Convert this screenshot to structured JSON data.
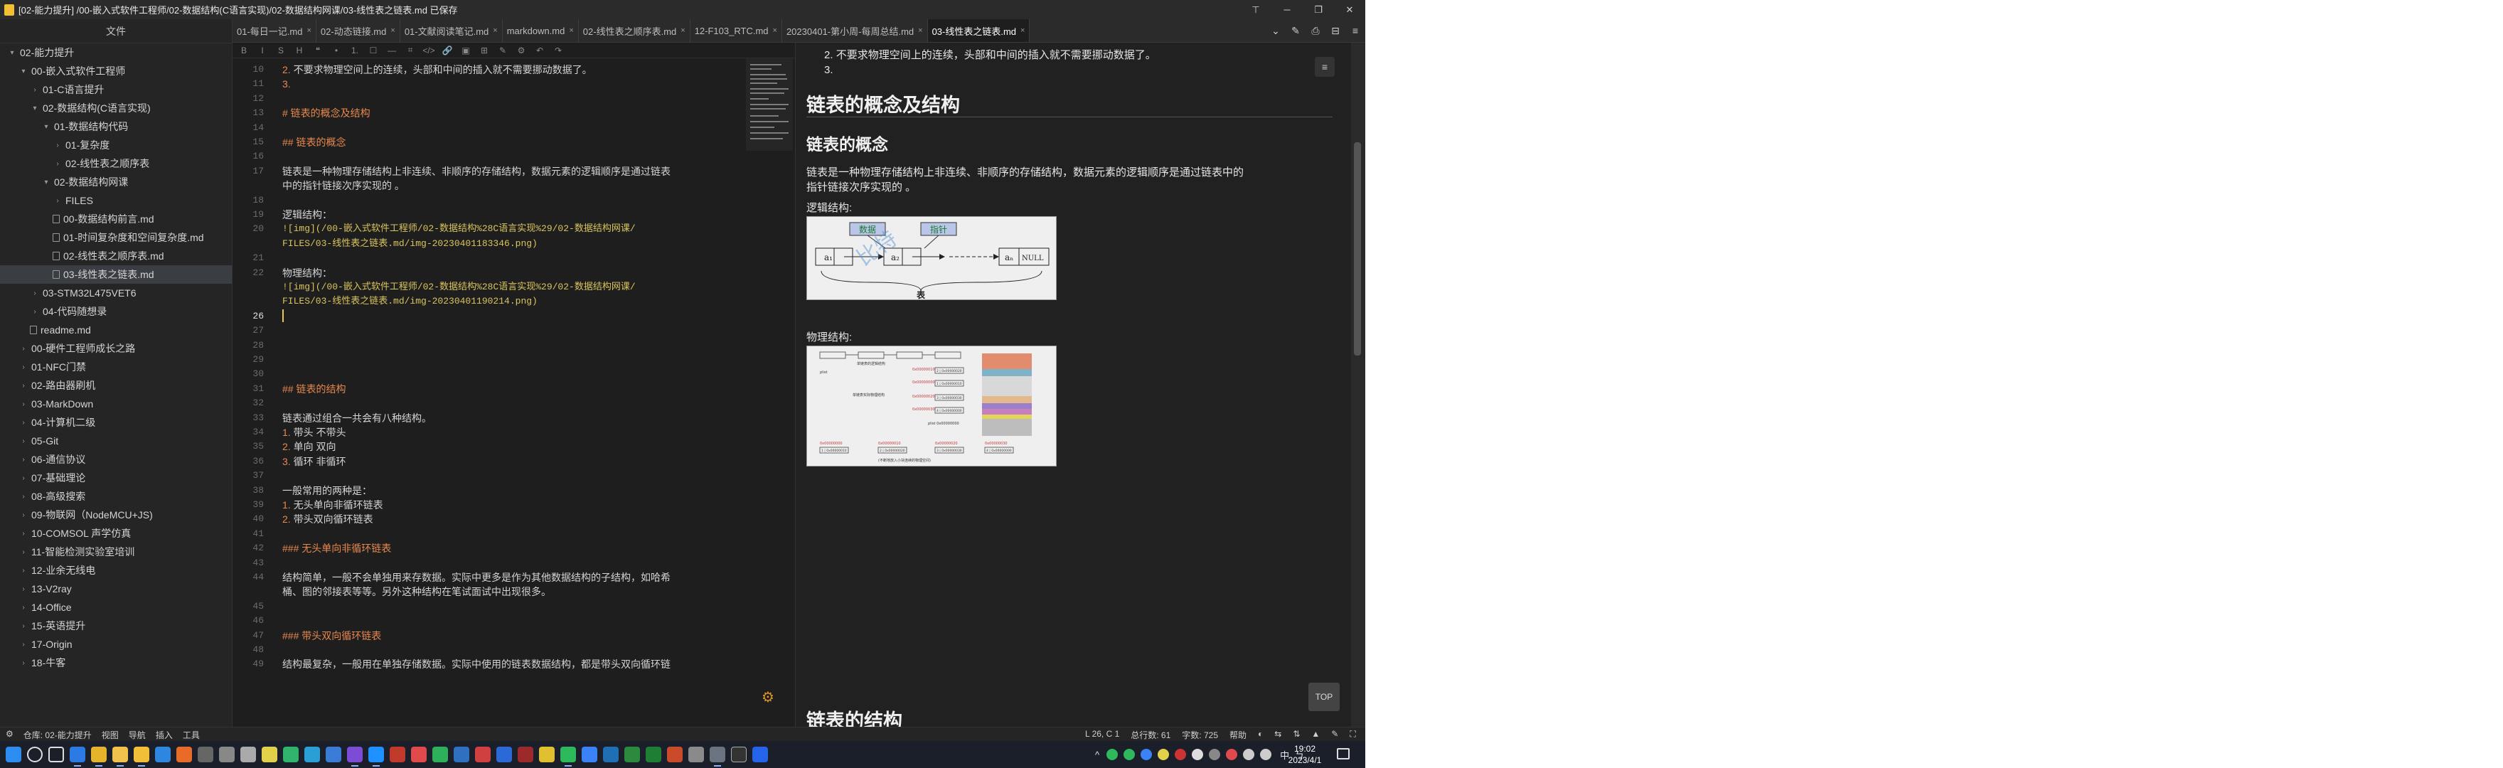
{
  "window": {
    "title": "[02-能力提升] /00-嵌入式软件工程师/02-数据结构(C语言实现)/02-数据结构网课/03-线性表之链表.md 已保存",
    "controls": [
      "─",
      "❐",
      "✕"
    ],
    "pin_label": "⊤"
  },
  "sidebar": {
    "header": "文件",
    "items": [
      {
        "label": "02-能力提升",
        "arrow": "▾",
        "indent": 10,
        "kind": "folder"
      },
      {
        "label": "00-嵌入式软件工程师",
        "arrow": "▾",
        "indent": 26,
        "kind": "folder"
      },
      {
        "label": "01-C语言提升",
        "arrow": "›",
        "indent": 42,
        "kind": "folder"
      },
      {
        "label": "02-数据结构(C语言实现)",
        "arrow": "▾",
        "indent": 42,
        "kind": "folder"
      },
      {
        "label": "01-数据结构代码",
        "arrow": "▾",
        "indent": 58,
        "kind": "folder"
      },
      {
        "label": "01-复杂度",
        "arrow": "›",
        "indent": 74,
        "kind": "folder"
      },
      {
        "label": "02-线性表之顺序表",
        "arrow": "›",
        "indent": 74,
        "kind": "folder"
      },
      {
        "label": "02-数据结构网课",
        "arrow": "▾",
        "indent": 58,
        "kind": "folder"
      },
      {
        "label": "FILES",
        "arrow": "›",
        "indent": 74,
        "kind": "folder"
      },
      {
        "label": "00-数据结构前言.md",
        "arrow": "",
        "indent": 74,
        "kind": "file"
      },
      {
        "label": "01-时间复杂度和空间复杂度.md",
        "arrow": "",
        "indent": 74,
        "kind": "file"
      },
      {
        "label": "02-线性表之顺序表.md",
        "arrow": "",
        "indent": 74,
        "kind": "file"
      },
      {
        "label": "03-线性表之链表.md",
        "arrow": "",
        "indent": 74,
        "kind": "file",
        "selected": true
      },
      {
        "label": "03-STM32L475VET6",
        "arrow": "›",
        "indent": 42,
        "kind": "folder"
      },
      {
        "label": "04-代码随想录",
        "arrow": "›",
        "indent": 42,
        "kind": "folder"
      },
      {
        "label": "readme.md",
        "arrow": "",
        "indent": 42,
        "kind": "file"
      },
      {
        "label": "00-硬件工程师成长之路",
        "arrow": "›",
        "indent": 26,
        "kind": "folder"
      },
      {
        "label": "01-NFC门禁",
        "arrow": "›",
        "indent": 26,
        "kind": "folder"
      },
      {
        "label": "02-路由器刷机",
        "arrow": "›",
        "indent": 26,
        "kind": "folder"
      },
      {
        "label": "03-MarkDown",
        "arrow": "›",
        "indent": 26,
        "kind": "folder"
      },
      {
        "label": "04-计算机二级",
        "arrow": "›",
        "indent": 26,
        "kind": "folder"
      },
      {
        "label": "05-Git",
        "arrow": "›",
        "indent": 26,
        "kind": "folder"
      },
      {
        "label": "06-通信协议",
        "arrow": "›",
        "indent": 26,
        "kind": "folder"
      },
      {
        "label": "07-基础理论",
        "arrow": "›",
        "indent": 26,
        "kind": "folder"
      },
      {
        "label": "08-高级搜索",
        "arrow": "›",
        "indent": 26,
        "kind": "folder"
      },
      {
        "label": "09-物联网（NodeMCU+JS)",
        "arrow": "›",
        "indent": 26,
        "kind": "folder"
      },
      {
        "label": "10-COMSOL 声学仿真",
        "arrow": "›",
        "indent": 26,
        "kind": "folder"
      },
      {
        "label": "11-智能检测实验室培训",
        "arrow": "›",
        "indent": 26,
        "kind": "folder"
      },
      {
        "label": "12-业余无线电",
        "arrow": "›",
        "indent": 26,
        "kind": "folder"
      },
      {
        "label": "13-V2ray",
        "arrow": "›",
        "indent": 26,
        "kind": "folder"
      },
      {
        "label": "14-Office",
        "arrow": "›",
        "indent": 26,
        "kind": "folder"
      },
      {
        "label": "15-英语提升",
        "arrow": "›",
        "indent": 26,
        "kind": "folder"
      },
      {
        "label": "17-Origin",
        "arrow": "›",
        "indent": 26,
        "kind": "folder"
      },
      {
        "label": "18-牛客",
        "arrow": "›",
        "indent": 26,
        "kind": "folder"
      }
    ]
  },
  "tabs": [
    {
      "label": "01-每日一记.md",
      "active": false
    },
    {
      "label": "02-动态链接.md",
      "active": false
    },
    {
      "label": "01-文献阅读笔记.md",
      "active": false
    },
    {
      "label": "markdown.md",
      "active": false
    },
    {
      "label": "02-线性表之顺序表.md",
      "active": false
    },
    {
      "label": "12-F103_RTC.md",
      "active": false
    },
    {
      "label": "20230401-第小周-每周总结.md",
      "active": false
    },
    {
      "label": "03-线性表之链表.md",
      "active": true
    }
  ],
  "tab_tools": [
    "⌄",
    "✎",
    "⎙",
    "⊟",
    "≡"
  ],
  "editor_toolbar": [
    "B",
    "I",
    "S",
    "H",
    "❝",
    "•",
    "1.",
    "☐",
    "—",
    "⌗",
    "</>",
    "🔗",
    "▣",
    "⊞",
    "✎",
    "⚙",
    "↶",
    "↷"
  ],
  "editor_lines": [
    {
      "n": "10",
      "kind": "list",
      "num": "2.",
      "text": " 不要求物理空间上的连续，头部和中间的插入就不需要挪动数据了。"
    },
    {
      "n": "11",
      "kind": "list",
      "num": "3.",
      "text": ""
    },
    {
      "n": "12",
      "kind": "text",
      "text": ""
    },
    {
      "n": "13",
      "kind": "heading",
      "text": "# 链表的概念及结构"
    },
    {
      "n": "14",
      "kind": "text",
      "text": ""
    },
    {
      "n": "15",
      "kind": "heading",
      "text": "## 链表的概念"
    },
    {
      "n": "16",
      "kind": "text",
      "text": ""
    },
    {
      "n": "17",
      "kind": "text",
      "text": "链表是一种物理存储结构上非连续、非顺序的存储结构，数据元素的逻辑顺序是通过链表"
    },
    {
      "n": "",
      "kind": "text",
      "text": "中的指针链接次序实现的 。"
    },
    {
      "n": "18",
      "kind": "text",
      "text": ""
    },
    {
      "n": "19",
      "kind": "text",
      "text": "逻辑结构："
    },
    {
      "n": "20",
      "kind": "link",
      "text": "![img](/00-嵌入式软件工程师/02-数据结构%28C语言实现%29/02-数据结构网课/"
    },
    {
      "n": "",
      "kind": "link",
      "text": "FILES/03-线性表之链表.md/img-20230401183346.png)"
    },
    {
      "n": "21",
      "kind": "text",
      "text": ""
    },
    {
      "n": "22",
      "kind": "text",
      "text": "物理结构："
    },
    {
      "n": "",
      "kind": "link",
      "text": "![img](/00-嵌入式软件工程师/02-数据结构%28C语言实现%29/02-数据结构网课/"
    },
    {
      "n": "",
      "kind": "link",
      "text": "FILES/03-线性表之链表.md/img-20230401190214.png)"
    },
    {
      "n": "26",
      "kind": "cursor",
      "text": ""
    },
    {
      "n": "27",
      "kind": "text",
      "text": ""
    },
    {
      "n": "28",
      "kind": "text",
      "text": ""
    },
    {
      "n": "29",
      "kind": "text",
      "text": ""
    },
    {
      "n": "30",
      "kind": "text",
      "text": ""
    },
    {
      "n": "31",
      "kind": "heading",
      "text": "## 链表的结构"
    },
    {
      "n": "32",
      "kind": "text",
      "text": ""
    },
    {
      "n": "33",
      "kind": "text",
      "text": "链表通过组合一共会有八种结构。"
    },
    {
      "n": "34",
      "kind": "list",
      "num": "1.",
      "text": " 带头  不带头"
    },
    {
      "n": "35",
      "kind": "list",
      "num": "2.",
      "text": " 单向  双向"
    },
    {
      "n": "36",
      "kind": "list",
      "num": "3.",
      "text": " 循环  非循环"
    },
    {
      "n": "37",
      "kind": "text",
      "text": ""
    },
    {
      "n": "38",
      "kind": "text",
      "text": "一般常用的两种是："
    },
    {
      "n": "39",
      "kind": "list",
      "num": "1.",
      "text": " 无头单向非循环链表"
    },
    {
      "n": "40",
      "kind": "list",
      "num": "2.",
      "text": " 带头双向循环链表"
    },
    {
      "n": "41",
      "kind": "text",
      "text": ""
    },
    {
      "n": "42",
      "kind": "heading",
      "text": "### 无头单向非循环链表"
    },
    {
      "n": "43",
      "kind": "text",
      "text": ""
    },
    {
      "n": "44",
      "kind": "text",
      "text": "结构简单，一般不会单独用来存数据。实际中更多是作为其他数据结构的子结构，如哈希"
    },
    {
      "n": "",
      "kind": "text",
      "text": "桶、图的邻接表等等。另外这种结构在笔试面试中出现很多。"
    },
    {
      "n": "45",
      "kind": "text",
      "text": ""
    },
    {
      "n": "46",
      "kind": "text",
      "text": ""
    },
    {
      "n": "47",
      "kind": "heading",
      "text": "### 带头双向循环链表"
    },
    {
      "n": "48",
      "kind": "text",
      "text": ""
    },
    {
      "n": "49",
      "kind": "text",
      "text": "结构最复杂，一般用在单独存储数据。实际中使用的链表数据结构，都是带头双向循环链"
    }
  ],
  "preview": {
    "list_top": [
      {
        "num": "2.",
        "text": "不要求物理空间上的连续，头部和中间的插入就不需要挪动数据了。"
      },
      {
        "num": "3.",
        "text": ""
      }
    ],
    "h1": "链表的概念及结构",
    "h2": "链表的概念",
    "para": "链表是一种物理存储结构上非连续、非顺序的存储结构，数据元素的逻辑顺序是通过链表中的指针链接次序实现的 。",
    "logic_label": "逻辑结构:",
    "physical_label": "物理结构:",
    "diagram": {
      "data_label": "数据",
      "ptr_label": "指针",
      "node_a1": "a₁",
      "node_a2": "a₂",
      "node_an": "aₙ",
      "null_label": "NULL",
      "table_label": "表",
      "watermark": "比特"
    },
    "phys": {
      "head_label": "plist",
      "head_addr_label": "plist 0x00000000",
      "list_title": "单链表的逻辑结构",
      "phys_title": "单链表实际物理结构",
      "bottom_note": "(不断地放入小块连续的物理空间)",
      "addr1": "0x00000000",
      "addr2": "0x00000010",
      "addr3": "0x00000020",
      "addr4": "0x00000030",
      "cells": [
        "1 | 0x00000010",
        "2 | 0x00000020",
        "3 | 0x00000030",
        "4 | 0x00000000"
      ]
    },
    "next_h1": "链表的结构",
    "top_label": "TOP",
    "toc_icon": "≡"
  },
  "status": {
    "left": [
      "⚙",
      "仓库: 02-能力提升",
      "视图",
      "导航",
      "插入",
      "工具"
    ],
    "right": [
      "L 26, C 1",
      "总行数: 61",
      "字数: 725",
      "帮助",
      "◐",
      "⇆",
      "⇅",
      "▲",
      "✎",
      "⛶"
    ]
  },
  "taskbar": {
    "clock_time": "19:02",
    "clock_date": "2023/4/1",
    "tray_labels": [
      "^",
      "中",
      "ㄅ"
    ]
  },
  "colors": {
    "accent_heading": "#e8884d",
    "link": "#d9c45d",
    "editor_bg": "#1e1e1e",
    "taskbar_bg": "#1b1f2a"
  }
}
